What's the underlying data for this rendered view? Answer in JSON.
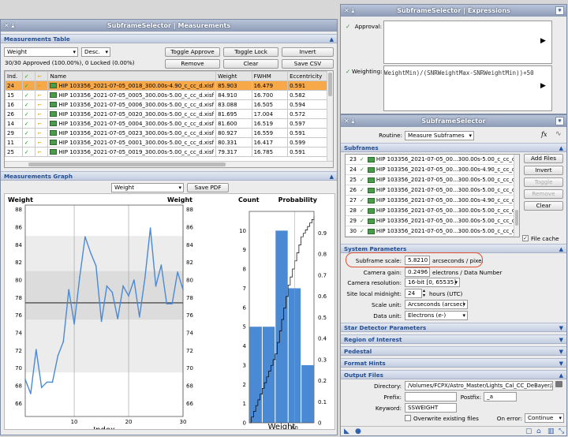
{
  "meas": {
    "title": "SubframeSelector | Measurements",
    "table_section": "Measurements Table",
    "sort_by": "Weight",
    "sort_dir": "Desc.",
    "status": "30/30 Approved (100.00%), 0 Locked (0.00%)",
    "btn_toggle_approve": "Toggle Approve",
    "btn_toggle_lock": "Toggle Lock",
    "btn_invert": "Invert",
    "btn_remove": "Remove",
    "btn_clear": "Clear",
    "btn_save_csv": "Save CSV",
    "cols": [
      "Ind.",
      "",
      "",
      "Name",
      "Weight",
      "FWHM",
      "Eccentricity"
    ],
    "rows": [
      {
        "ind": "24",
        "name": "HIP 103356_2021-07-05_0018_300.00s-4.90_c_cc_d.xisf",
        "weight": "85.903",
        "fwhm": "16.479",
        "ecc": "0.591"
      },
      {
        "ind": "15",
        "name": "HIP 103356_2021-07-05_0005_300.00s-5.00_c_cc_d.xisf",
        "weight": "84.910",
        "fwhm": "16.700",
        "ecc": "0.582"
      },
      {
        "ind": "16",
        "name": "HIP 103356_2021-07-05_0006_300.00s-5.00_c_cc_d.xisf",
        "weight": "83.088",
        "fwhm": "16.505",
        "ecc": "0.594"
      },
      {
        "ind": "26",
        "name": "HIP 103356_2021-07-05_0020_300.00s-5.00_c_cc_d.xisf",
        "weight": "81.695",
        "fwhm": "17.004",
        "ecc": "0.572"
      },
      {
        "ind": "14",
        "name": "HIP 103356_2021-07-05_0004_300.00s-5.00_c_cc_d.xisf",
        "weight": "81.600",
        "fwhm": "16.519",
        "ecc": "0.597"
      },
      {
        "ind": "29",
        "name": "HIP 103356_2021-07-05_0023_300.00s-5.00_c_cc_d.xisf",
        "weight": "80.927",
        "fwhm": "16.559",
        "ecc": "0.591"
      },
      {
        "ind": "11",
        "name": "HIP 103356_2021-07-05_0001_300.00s-5.00_c_cc_d.xisf",
        "weight": "80.331",
        "fwhm": "16.417",
        "ecc": "0.599"
      },
      {
        "ind": "25",
        "name": "HIP 103356_2021-07-05_0019_300.00s-5.00_c_cc_d.xisf",
        "weight": "79.317",
        "fwhm": "16.785",
        "ecc": "0.591"
      }
    ],
    "graph_section": "Measurements Graph",
    "graph_prop": "Weight",
    "btn_save_pdf": "Save PDF"
  },
  "chart_data": [
    {
      "type": "line",
      "title": "",
      "ylabel": "Weight",
      "ylabel_right": "Weight",
      "xlabel": "Index",
      "xlim": [
        1,
        30
      ],
      "ylim": [
        64.5,
        88.5
      ],
      "xticks": [
        10,
        20,
        30
      ],
      "yticks": [
        66,
        68,
        70,
        72,
        74,
        76,
        78,
        80,
        82,
        84,
        86,
        88
      ],
      "median": 77.4,
      "x": [
        1,
        2,
        3,
        4,
        5,
        6,
        7,
        8,
        9,
        10,
        11,
        12,
        13,
        14,
        15,
        16,
        17,
        18,
        19,
        20,
        21,
        22,
        23,
        24,
        25,
        26,
        27,
        28,
        29,
        30
      ],
      "values": [
        68.7,
        67.1,
        72.1,
        67.8,
        68.4,
        68.4,
        71.4,
        73.0,
        78.9,
        75.0,
        80.3,
        84.9,
        83.1,
        81.6,
        75.3,
        79.3,
        78.6,
        75.6,
        79.3,
        78.2,
        80.0,
        75.8,
        80.2,
        85.9,
        79.3,
        81.7,
        77.3,
        77.3,
        80.9,
        78.9
      ]
    },
    {
      "type": "histogram",
      "ylabel": "Count",
      "ylabel_right": "Probability",
      "xlabel": "Weight",
      "xticks": [
        80
      ],
      "bins": [
        "66-70",
        "70-74",
        "74-78",
        "78-82",
        "82-86"
      ],
      "counts": [
        5,
        5,
        10,
        7,
        3
      ],
      "ylim": [
        0,
        11
      ],
      "yticks": [
        0,
        1,
        2,
        3,
        4,
        5,
        6,
        7,
        8,
        9,
        10
      ],
      "prob_ticks": [
        0,
        0.1,
        0.2,
        0.3,
        0.4,
        0.5,
        0.6,
        0.7,
        0.8,
        0.9
      ]
    }
  ],
  "expr": {
    "title": "SubframeSelector | Expressions",
    "approval_label": "Approval:",
    "weighting_label": "Weighting:",
    "weighting_text": "WeightMin)/(SNRWeightMax-SNRWeightMin))+50"
  },
  "ss": {
    "title": "SubframeSelector",
    "routine_label": "Routine:",
    "routine": "Measure Subframes",
    "subframes_section": "Subframes",
    "subframes": [
      {
        "n": "23",
        "name": "HIP 103356_2021-07-05_00...300.00s-5.00_c_cc_d.xisf"
      },
      {
        "n": "24",
        "name": "HIP 103356_2021-07-05_00...300.00s-4.90_c_cc_d.xisf"
      },
      {
        "n": "25",
        "name": "HIP 103356_2021-07-05_00...300.00s-5.00_c_cc_d.xisf"
      },
      {
        "n": "26",
        "name": "HIP 103356_2021-07-05_00...300.00s-5.00_c_cc_d.xisf"
      },
      {
        "n": "27",
        "name": "HIP 103356_2021-07-05_00...300.00s-4.90_c_cc_d.xisf"
      },
      {
        "n": "28",
        "name": "HIP 103356_2021-07-05_00...300.00s-5.00_c_cc_d.xisf"
      },
      {
        "n": "29",
        "name": "HIP 103356_2021-07-05_00...300.00s-5.00_c_cc_d.xisf"
      },
      {
        "n": "30",
        "name": "HIP 103356_2021-07-05_00...300.00s-5.00_c_cc_d.xisf"
      }
    ],
    "btn_add_files": "Add Files",
    "btn_invert": "Invert",
    "btn_toggle": "Toggle",
    "btn_remove": "Remove",
    "btn_clear": "Clear",
    "file_cache": "File cache",
    "system_section": "System Parameters",
    "scale_label": "Subframe scale:",
    "scale_value": "5.8210",
    "scale_unit": "arcseconds / pixel",
    "gain_label": "Camera gain:",
    "gain_value": "0.2496",
    "gain_unit": "electrons / Data Number",
    "res_label": "Camera resolution:",
    "res_value": "16-bit [0, 65535]",
    "midnight_label": "Site local midnight:",
    "midnight_value": "24",
    "midnight_unit": "hours (UTC)",
    "scale_unit_label": "Scale unit:",
    "scale_unit_value": "Arcseconds (arcsec)",
    "data_unit_label": "Data unit:",
    "data_unit_value": "Electrons (e-)",
    "sections": [
      "Star Detector Parameters",
      "Region of Interest",
      "Pedestal",
      "Format Hints"
    ],
    "output_section": "Output Files",
    "dir_label": "Directory:",
    "dir_value": "/Volumes/FCPX/Astro_Master/Lights_Cal_CC_DeBayer/Approved",
    "prefix_label": "Prefix:",
    "prefix_value": "",
    "postfix_label": "Postfix:",
    "postfix_value": "_a",
    "keyword_label": "Keyword:",
    "keyword_value": "SSWEIGHT",
    "overwrite_label": "Overwrite existing files",
    "onerror_label": "On error:",
    "onerror_value": "Continue"
  },
  "colors": {
    "accent": "#234e92",
    "selection": "#f7a94a",
    "series": "#4a8ad4",
    "highlight": "#e05030"
  }
}
